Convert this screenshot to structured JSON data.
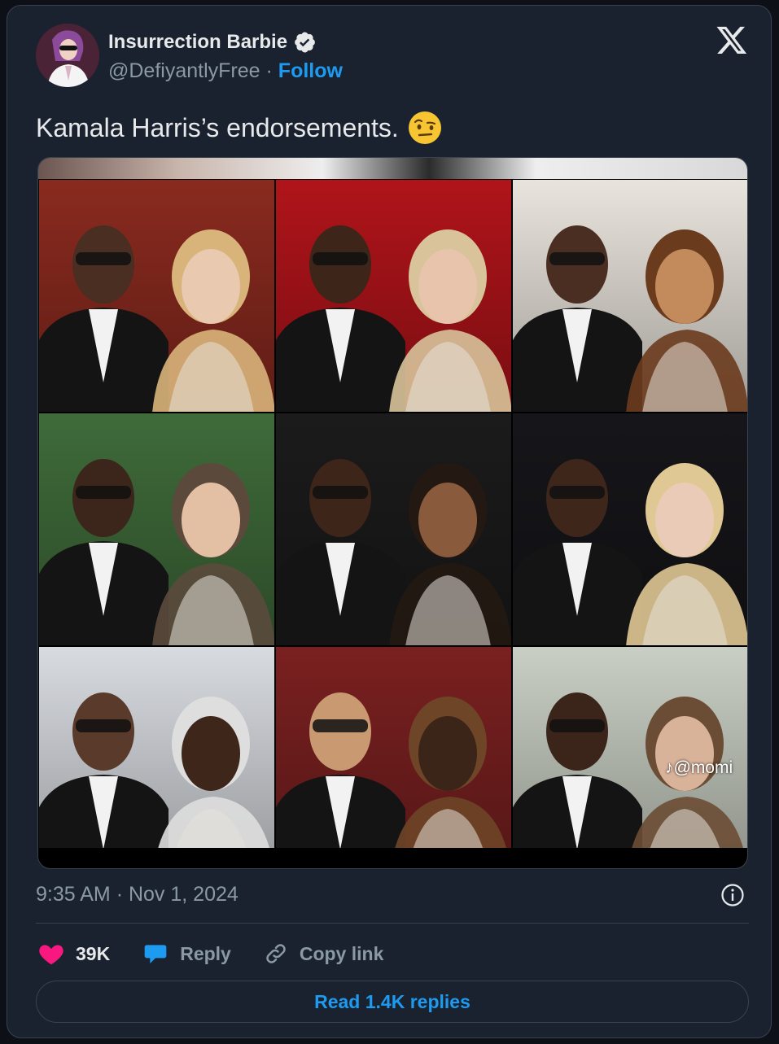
{
  "author": {
    "display_name": "Insurrection Barbie",
    "handle": "@DefiyantlyFree",
    "separator": "·",
    "follow_label": "Follow",
    "verified": true
  },
  "tweet": {
    "text": "Kamala Harris’s endorsements.",
    "emoji": "face-with-raised-eyebrow"
  },
  "media": {
    "watermark": "@momi",
    "tiles": [
      {
        "name": "photo-tile-1",
        "bg": "#8a2a1f",
        "left_skin": "#4a2e22",
        "right_skin": "#e9c9b0",
        "right_hair": "#d9b47a"
      },
      {
        "name": "photo-tile-2",
        "bg": "#b0141a",
        "left_skin": "#3e2519",
        "right_skin": "#e8c4ad",
        "right_hair": "#d8c39a"
      },
      {
        "name": "photo-tile-3",
        "bg": "#e9e4dc",
        "left_skin": "#4b2e22",
        "right_skin": "#c38b5c",
        "right_hair": "#6b3b1d"
      },
      {
        "name": "photo-tile-4",
        "bg": "#3f6b3a",
        "left_skin": "#3c251a",
        "right_skin": "#e3bfa4",
        "right_hair": "#5b4a3c"
      },
      {
        "name": "photo-tile-5",
        "bg": "#1b1b1b",
        "left_skin": "#3d2519",
        "right_skin": "#8a5a3c",
        "right_hair": "#241812"
      },
      {
        "name": "photo-tile-6",
        "bg": "#16161a",
        "left_skin": "#3e261b",
        "right_skin": "#eacbb7",
        "right_hair": "#e0c894"
      },
      {
        "name": "photo-tile-7",
        "bg": "#d8dbe0",
        "left_skin": "#5a3a2a",
        "right_skin": "#3e261b",
        "right_hair": "#dedede"
      },
      {
        "name": "photo-tile-8",
        "bg": "#7a2020",
        "left_skin": "#c99a72",
        "right_skin": "#3b2418",
        "right_hair": "#6e4526"
      },
      {
        "name": "photo-tile-9",
        "bg": "#c9cfc4",
        "left_skin": "#3b2419",
        "right_skin": "#d9b29a",
        "right_hair": "#6b4c34"
      }
    ]
  },
  "meta": {
    "time": "9:35 AM",
    "separator": "·",
    "date": "Nov 1, 2024"
  },
  "actions": {
    "likes_count": "39K",
    "reply_label": "Reply",
    "copy_link_label": "Copy link"
  },
  "footer": {
    "read_replies_label": "Read 1.4K replies"
  },
  "colors": {
    "accent": "#1d9bf0",
    "like": "#f91880",
    "text_primary": "#e7e9ea",
    "text_secondary": "#8b98a5"
  }
}
